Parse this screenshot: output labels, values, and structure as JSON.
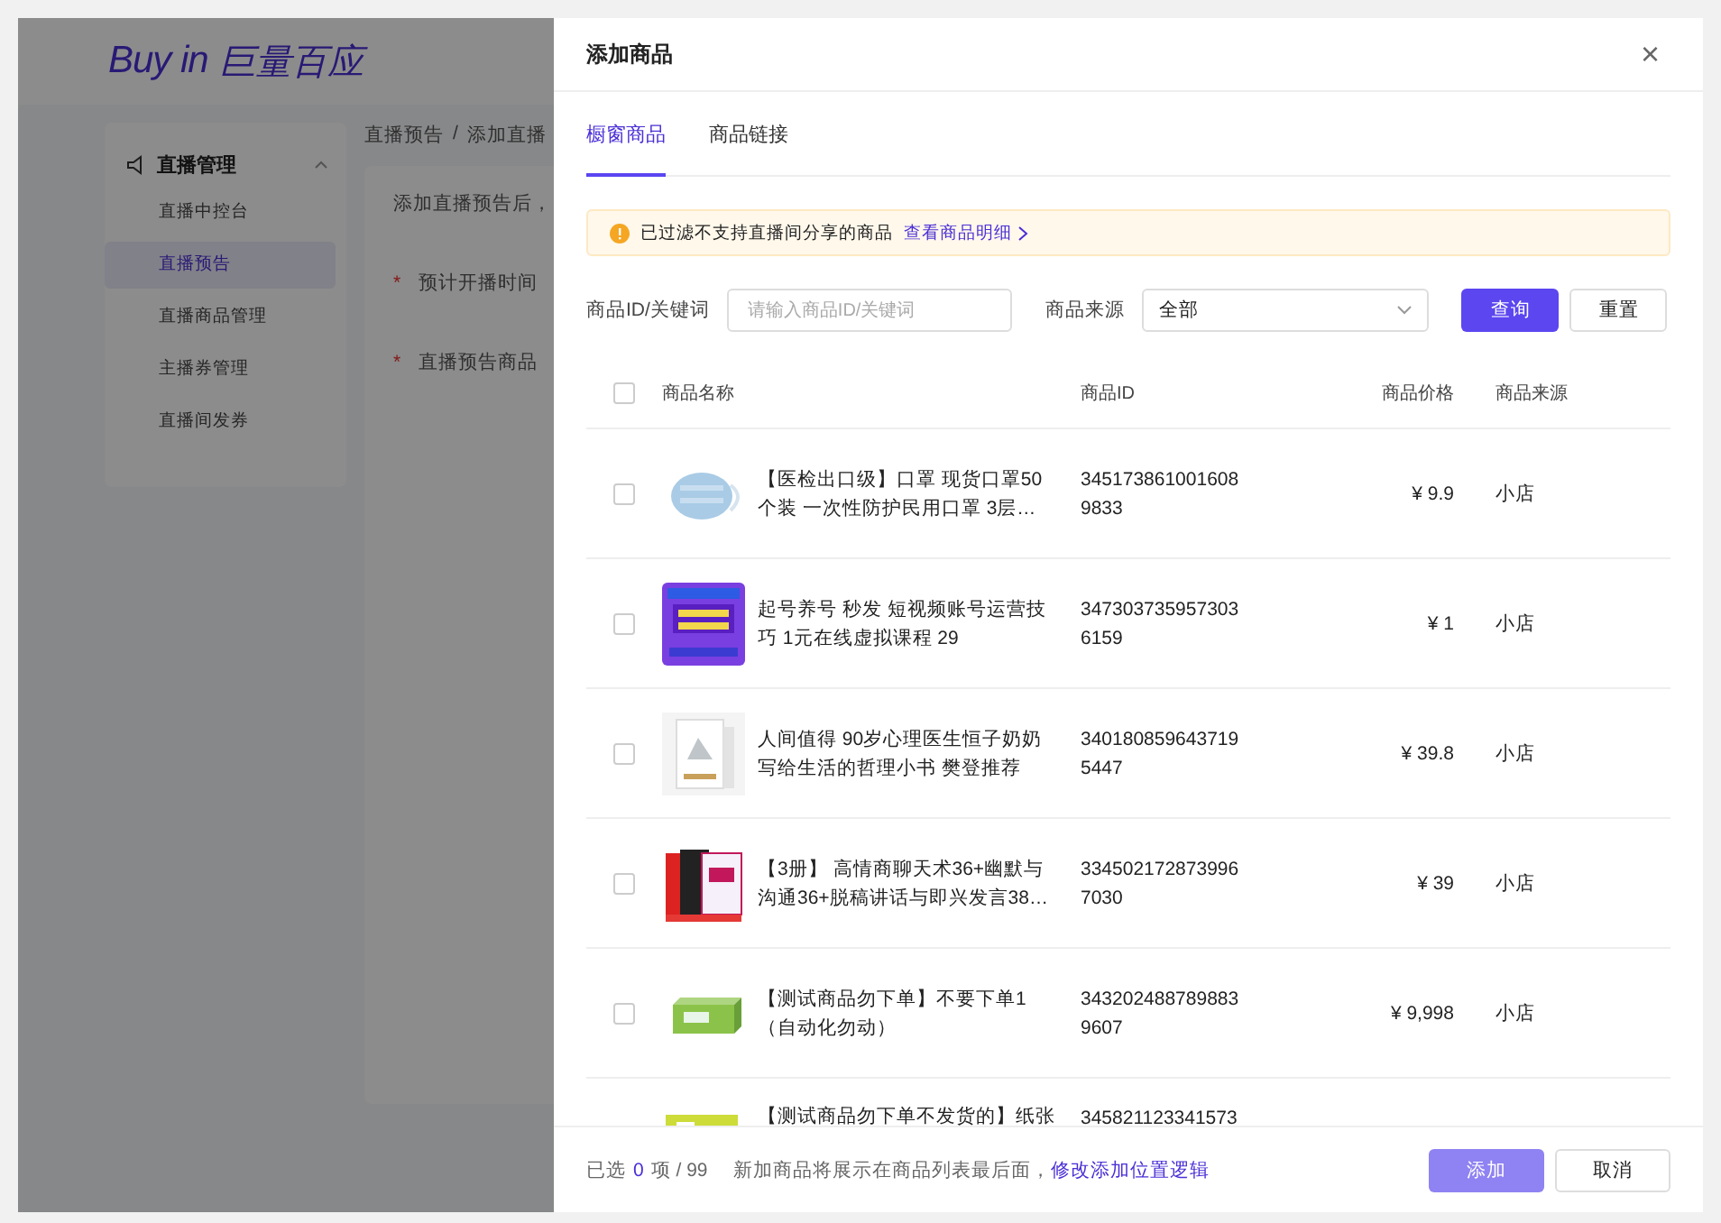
{
  "background_app": {
    "logo": {
      "latin": "Buy in",
      "chinese": "巨量百应"
    },
    "sidebar": {
      "group": {
        "label": "直播管理",
        "expanded": true
      },
      "items": [
        {
          "label": "直播中控台",
          "selected": false
        },
        {
          "label": "直播预告",
          "selected": true
        },
        {
          "label": "直播商品管理",
          "selected": false
        },
        {
          "label": "主播券管理",
          "selected": false
        },
        {
          "label": "直播间发券",
          "selected": false
        }
      ]
    },
    "breadcrumb": [
      "直播预告",
      "添加直播"
    ],
    "breadcrumb_separator": "/",
    "required_mark": "*",
    "intro": "添加直播预告后，",
    "form_fields": [
      {
        "label": "预计开播时间",
        "required": true
      },
      {
        "label": "直播预告商品",
        "required": true
      }
    ]
  },
  "drawer": {
    "title": "添加商品",
    "close": "×",
    "tabs": [
      {
        "label": "橱窗商品",
        "selected": true
      },
      {
        "label": "商品链接",
        "selected": false
      }
    ],
    "alert": {
      "text": "已过滤不支持直播间分享的商品",
      "link": "查看商品明细"
    },
    "filters": {
      "keyword_label": "商品ID/关键词",
      "keyword_placeholder": "请输入商品ID/关键词",
      "source_label": "商品来源",
      "source_value": "全部",
      "search_button": "查询",
      "reset_button": "重置"
    },
    "table": {
      "header_checked": false,
      "columns": [
        "商品名称",
        "商品ID",
        "商品价格",
        "商品来源"
      ],
      "rows": [
        {
          "checked": false,
          "name": "【医检出口级】口罩 现货口罩50个装 一次性防护民用口罩 3层…",
          "id": "3451738610016089833",
          "price": "¥ 9.9",
          "source": "小店"
        },
        {
          "checked": false,
          "name": "起号养号 秒发 短视频账号运营技巧 1元在线虚拟课程 29",
          "id": "3473037359573036159",
          "price": "¥ 1",
          "source": "小店"
        },
        {
          "checked": false,
          "name": "人间值得 90岁心理医生恒子奶奶写给生活的哲理小书 樊登推荐",
          "id": "3401808596437195447",
          "price": "¥ 39.8",
          "source": "小店"
        },
        {
          "checked": false,
          "name": "【3册】 高情商聊天术36+幽默与沟通36+脱稿讲话与即兴发言38…",
          "id": "3345021728739967030",
          "price": "¥ 39",
          "source": "小店"
        },
        {
          "checked": false,
          "name": "【测试商品勿下单】不要下单1（自动化勿动）",
          "id": "3432024887898839607",
          "price": "¥ 9,998",
          "source": "小店"
        },
        {
          "name": "【测试商品勿下单不发货的】纸张",
          "id": "345821123341573"
        }
      ]
    },
    "footer": {
      "selected_label": "已选",
      "selected_count": "0",
      "total": "项 / 99",
      "note": "新加商品将展示在商品列表最后面，",
      "note_link": "修改添加位置逻辑",
      "add_button": {
        "label": "添加",
        "disabled": true
      },
      "cancel_button": "取消"
    }
  }
}
